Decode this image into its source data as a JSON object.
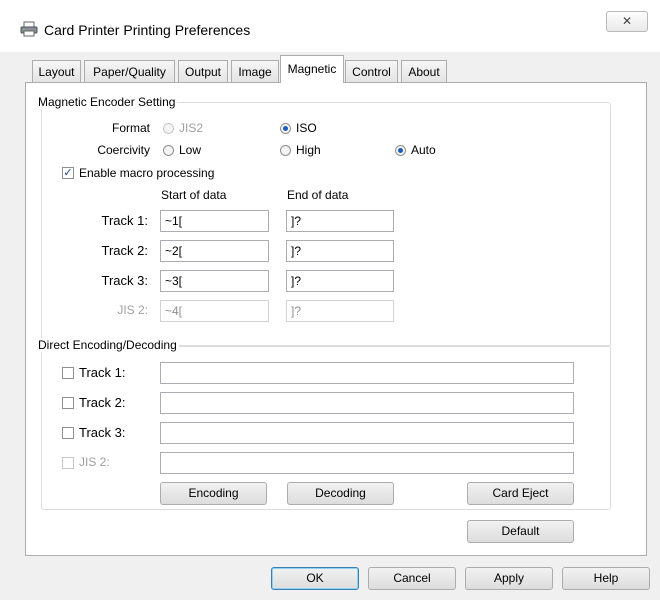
{
  "window": {
    "title": "Card Printer Printing Preferences",
    "close_glyph": "✕"
  },
  "tabs": [
    {
      "label": "Layout"
    },
    {
      "label": "Paper/Quality"
    },
    {
      "label": "Output"
    },
    {
      "label": "Image"
    },
    {
      "label": "Magnetic",
      "active": true
    },
    {
      "label": "Control"
    },
    {
      "label": "About"
    }
  ],
  "magnetic_encoder": {
    "group_title": "Magnetic Encoder Setting",
    "format_label": "Format",
    "format_options": [
      "JIS2",
      "ISO"
    ],
    "format_selected": "ISO",
    "coercivity_label": "Coercivity",
    "coercivity_options": [
      "Low",
      "High",
      "Auto"
    ],
    "coercivity_selected": "Auto",
    "macro_checkbox": {
      "label": "Enable macro processing",
      "checked": true
    },
    "col_start": "Start of data",
    "col_end": "End of data",
    "tracks": [
      {
        "label": "Track 1:",
        "start": "~1[",
        "end": "]?"
      },
      {
        "label": "Track 2:",
        "start": "~2[",
        "end": "]?"
      },
      {
        "label": "Track 3:",
        "start": "~3[",
        "end": "]?"
      },
      {
        "label": "JIS 2:",
        "start": "~4[",
        "end": "]?",
        "disabled": true
      }
    ]
  },
  "direct": {
    "group_title": "Direct Encoding/Decoding",
    "tracks": [
      {
        "label": "Track 1:",
        "value": ""
      },
      {
        "label": "Track 2:",
        "value": ""
      },
      {
        "label": "Track 3:",
        "value": ""
      },
      {
        "label": "JIS 2:",
        "value": "",
        "disabled": true
      }
    ],
    "encoding_label": "Encoding",
    "decoding_label": "Decoding",
    "card_eject_label": "Card Eject"
  },
  "default_label": "Default",
  "footer": {
    "ok": "OK",
    "cancel": "Cancel",
    "apply": "Apply",
    "help": "Help"
  },
  "icons": {
    "window_icon": "printer-icon",
    "checkmark": "✓"
  },
  "colors": {
    "radio_dot": "#1a5bbf",
    "default_button_border": "#3c7fb1"
  }
}
